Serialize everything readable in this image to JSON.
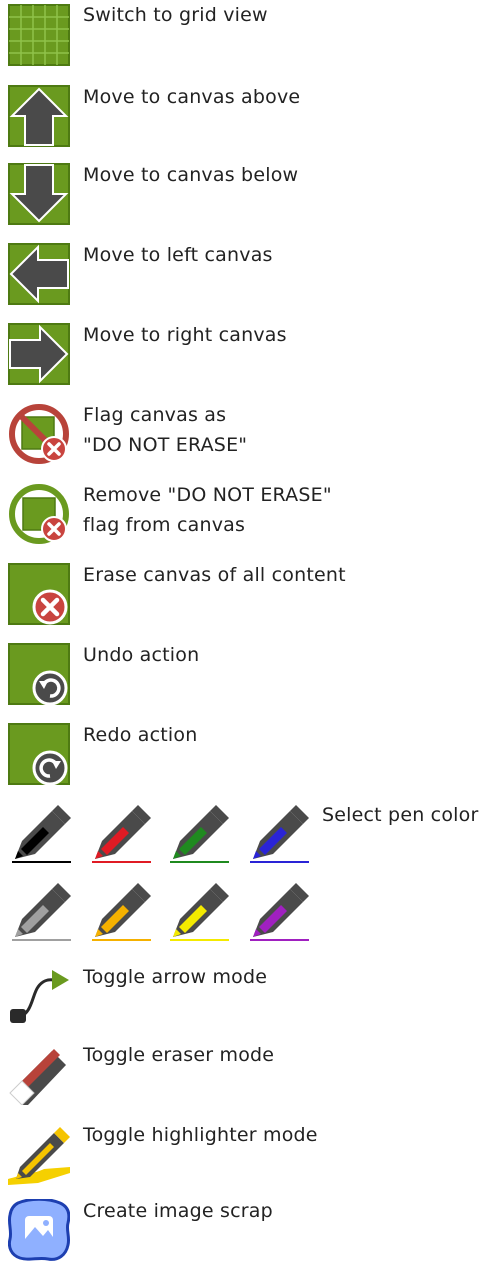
{
  "colors": {
    "accent_green": "#6a9a1f",
    "icon_dark": "#4a4a4a",
    "flag_red": "#b8433a",
    "badge_red": "#c9443f"
  },
  "items": {
    "grid_view": "Switch to grid view",
    "canvas_above": "Move to canvas above",
    "canvas_below": "Move to canvas below",
    "left_canvas": "Move to left canvas",
    "right_canvas": "Move to right canvas",
    "flag_line1": "Flag canvas as",
    "flag_line2": "\"DO NOT ERASE\"",
    "unflag_line1": "Remove \"DO NOT ERASE\"",
    "unflag_line2": "flag from canvas",
    "erase_all": "Erase canvas of all content",
    "undo": "Undo action",
    "redo": "Redo action",
    "select_pen": "Select pen color",
    "arrow_mode": "Toggle arrow mode",
    "eraser_mode": "Toggle eraser mode",
    "highlighter_mode": "Toggle highlighter mode",
    "image_scrap": "Create image scrap"
  },
  "pen_colors": [
    {
      "name": "black",
      "hex": "#000000"
    },
    {
      "name": "red",
      "hex": "#e01b24"
    },
    {
      "name": "green",
      "hex": "#1f8a1f"
    },
    {
      "name": "blue",
      "hex": "#2a24d6"
    },
    {
      "name": "gray",
      "hex": "#a0a0a0"
    },
    {
      "name": "orange",
      "hex": "#f5b100"
    },
    {
      "name": "yellow",
      "hex": "#f4ea00"
    },
    {
      "name": "purple",
      "hex": "#a020c0"
    }
  ]
}
